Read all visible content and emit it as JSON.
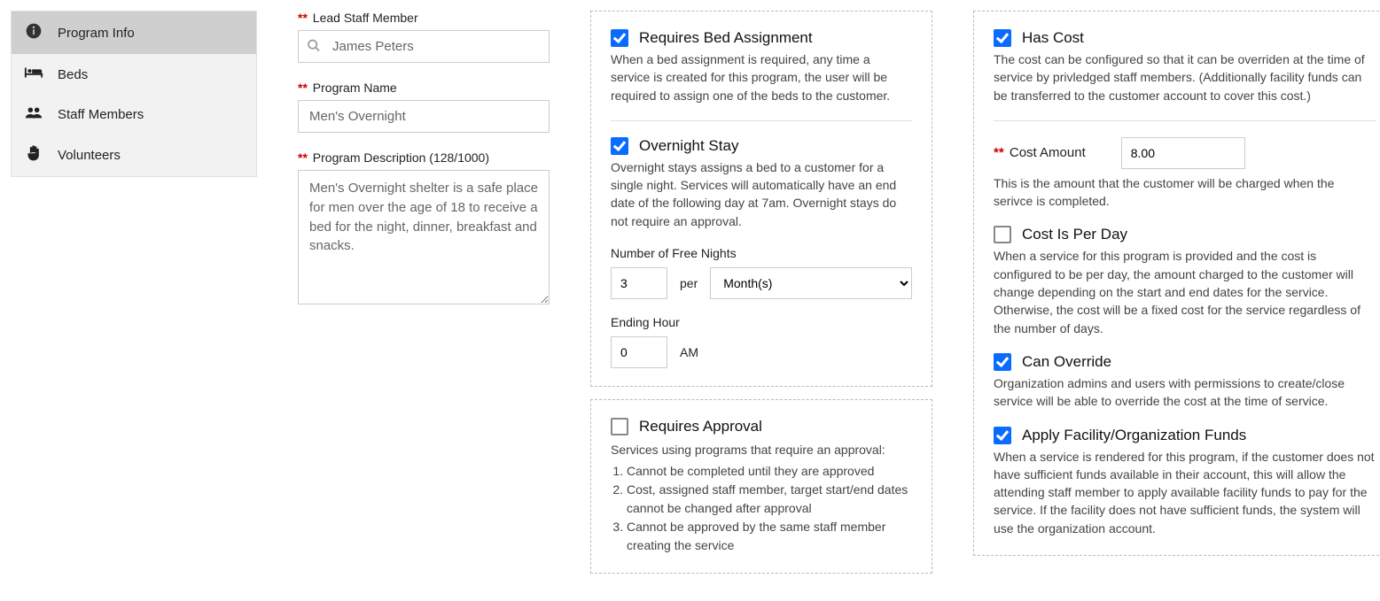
{
  "sidebar": {
    "items": [
      {
        "label": "Program Info",
        "icon": "info-icon",
        "active": true
      },
      {
        "label": "Beds",
        "icon": "bed-icon",
        "active": false
      },
      {
        "label": "Staff Members",
        "icon": "users-icon",
        "active": false
      },
      {
        "label": "Volunteers",
        "icon": "hand-icon",
        "active": false
      }
    ]
  },
  "form": {
    "lead_staff_label": "Lead Staff Member",
    "lead_staff_value": "James Peters",
    "program_name_label": "Program Name",
    "program_name_value": "Men's Overnight",
    "program_desc_label": "Program Description (128/1000)",
    "program_desc_value": "Men's Overnight shelter is a safe place for men over the age of 18 to receive a bed for the night, dinner, breakfast and snacks."
  },
  "bed_panel": {
    "requires_bed": {
      "checked": true,
      "title": "Requires Bed Assignment",
      "desc": "When a bed assignment is required, any time a service is created for this program, the user will be required to assign one of the beds to the customer."
    },
    "overnight": {
      "checked": true,
      "title": "Overnight Stay",
      "desc": "Overnight stays assigns a bed to a customer for a single night. Services will automatically have an end date of the following day at 7am. Overnight stays do not require an approval."
    },
    "free_nights_label": "Number of Free Nights",
    "free_nights_value": "3",
    "per_label": "per",
    "period_value": "Month(s)",
    "ending_hour_label": "Ending Hour",
    "ending_hour_value": "0",
    "ampm": "AM"
  },
  "approval_panel": {
    "requires_approval": {
      "checked": false,
      "title": "Requires Approval",
      "intro": "Services using programs that require an approval:",
      "rules": [
        "Cannot be completed until they are approved",
        "Cost, assigned staff member, target start/end dates cannot be changed after approval",
        "Cannot be approved by the same staff member creating the service"
      ]
    }
  },
  "cost_panel": {
    "has_cost": {
      "checked": true,
      "title": "Has Cost",
      "desc": "The cost can be configured so that it can be overriden at the time of service by privledged staff members. (Additionally facility funds can be transferred to the customer account to cover this cost.)"
    },
    "cost_amount_label": "Cost Amount",
    "cost_amount_value": "8.00",
    "cost_amount_desc": "This is the amount that the customer will be charged when the serivce is completed.",
    "per_day": {
      "checked": false,
      "title": "Cost Is Per Day",
      "desc": "When a service for this program is provided and the cost is configured to be per day, the amount charged to the customer will change depending on the start and end dates for the service. Otherwise, the cost will be a fixed cost for the service regardless of the number of days."
    },
    "override": {
      "checked": true,
      "title": "Can Override",
      "desc": "Organization admins and users with permissions to create/close service will be able to override the cost at the time of service."
    },
    "funds": {
      "checked": true,
      "title": "Apply Facility/Organization Funds",
      "desc": "When a service is rendered for this program, if the customer does not have sufficient funds available in their account, this will allow the attending staff member to apply available facility funds to pay for the service. If the facility does not have sufficient funds, the system will use the organization account."
    }
  }
}
